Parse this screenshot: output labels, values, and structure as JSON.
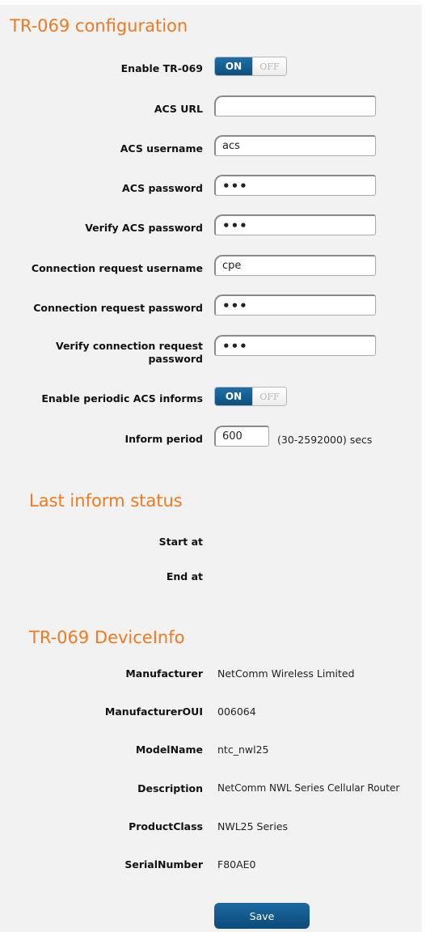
{
  "config": {
    "title": "TR-069 configuration",
    "enable_tr069": {
      "label": "Enable TR-069",
      "on": "ON",
      "off": "OFF",
      "state": "on"
    },
    "acs_url": {
      "label": "ACS URL",
      "value": ""
    },
    "acs_username": {
      "label": "ACS username",
      "value": "acs"
    },
    "acs_password": {
      "label": "ACS password",
      "value": "•••"
    },
    "verify_acs_password": {
      "label": "Verify ACS password",
      "value": "•••"
    },
    "conn_req_username": {
      "label": "Connection request username",
      "value": "cpe"
    },
    "conn_req_password": {
      "label": "Connection request password",
      "value": "•••"
    },
    "verify_conn_req_password": {
      "label": "Verify connection request password",
      "value": "•••"
    },
    "periodic_informs": {
      "label": "Enable periodic ACS informs",
      "on": "ON",
      "off": "OFF",
      "state": "on"
    },
    "inform_period": {
      "label": "Inform period",
      "value": "600",
      "hint": "(30-2592000) secs"
    }
  },
  "status": {
    "title": "Last inform status",
    "start_label": "Start at",
    "end_label": "End at"
  },
  "device_info": {
    "title": "TR-069 DeviceInfo",
    "rows": [
      {
        "label": "Manufacturer",
        "value": "NetComm Wireless Limited"
      },
      {
        "label": "ManufacturerOUI",
        "value": "006064"
      },
      {
        "label": "ModelName",
        "value": "ntc_nwl25"
      },
      {
        "label": "Description",
        "value": "NetComm NWL Series Cellular Router"
      },
      {
        "label": "ProductClass",
        "value": "NWL25 Series"
      },
      {
        "label": "SerialNumber",
        "value": "F80AE0"
      }
    ]
  },
  "save_label": "Save",
  "colors": {
    "accent": "#f07a1f",
    "button": "#0e4f7d",
    "panel": "#f2f2f2"
  }
}
